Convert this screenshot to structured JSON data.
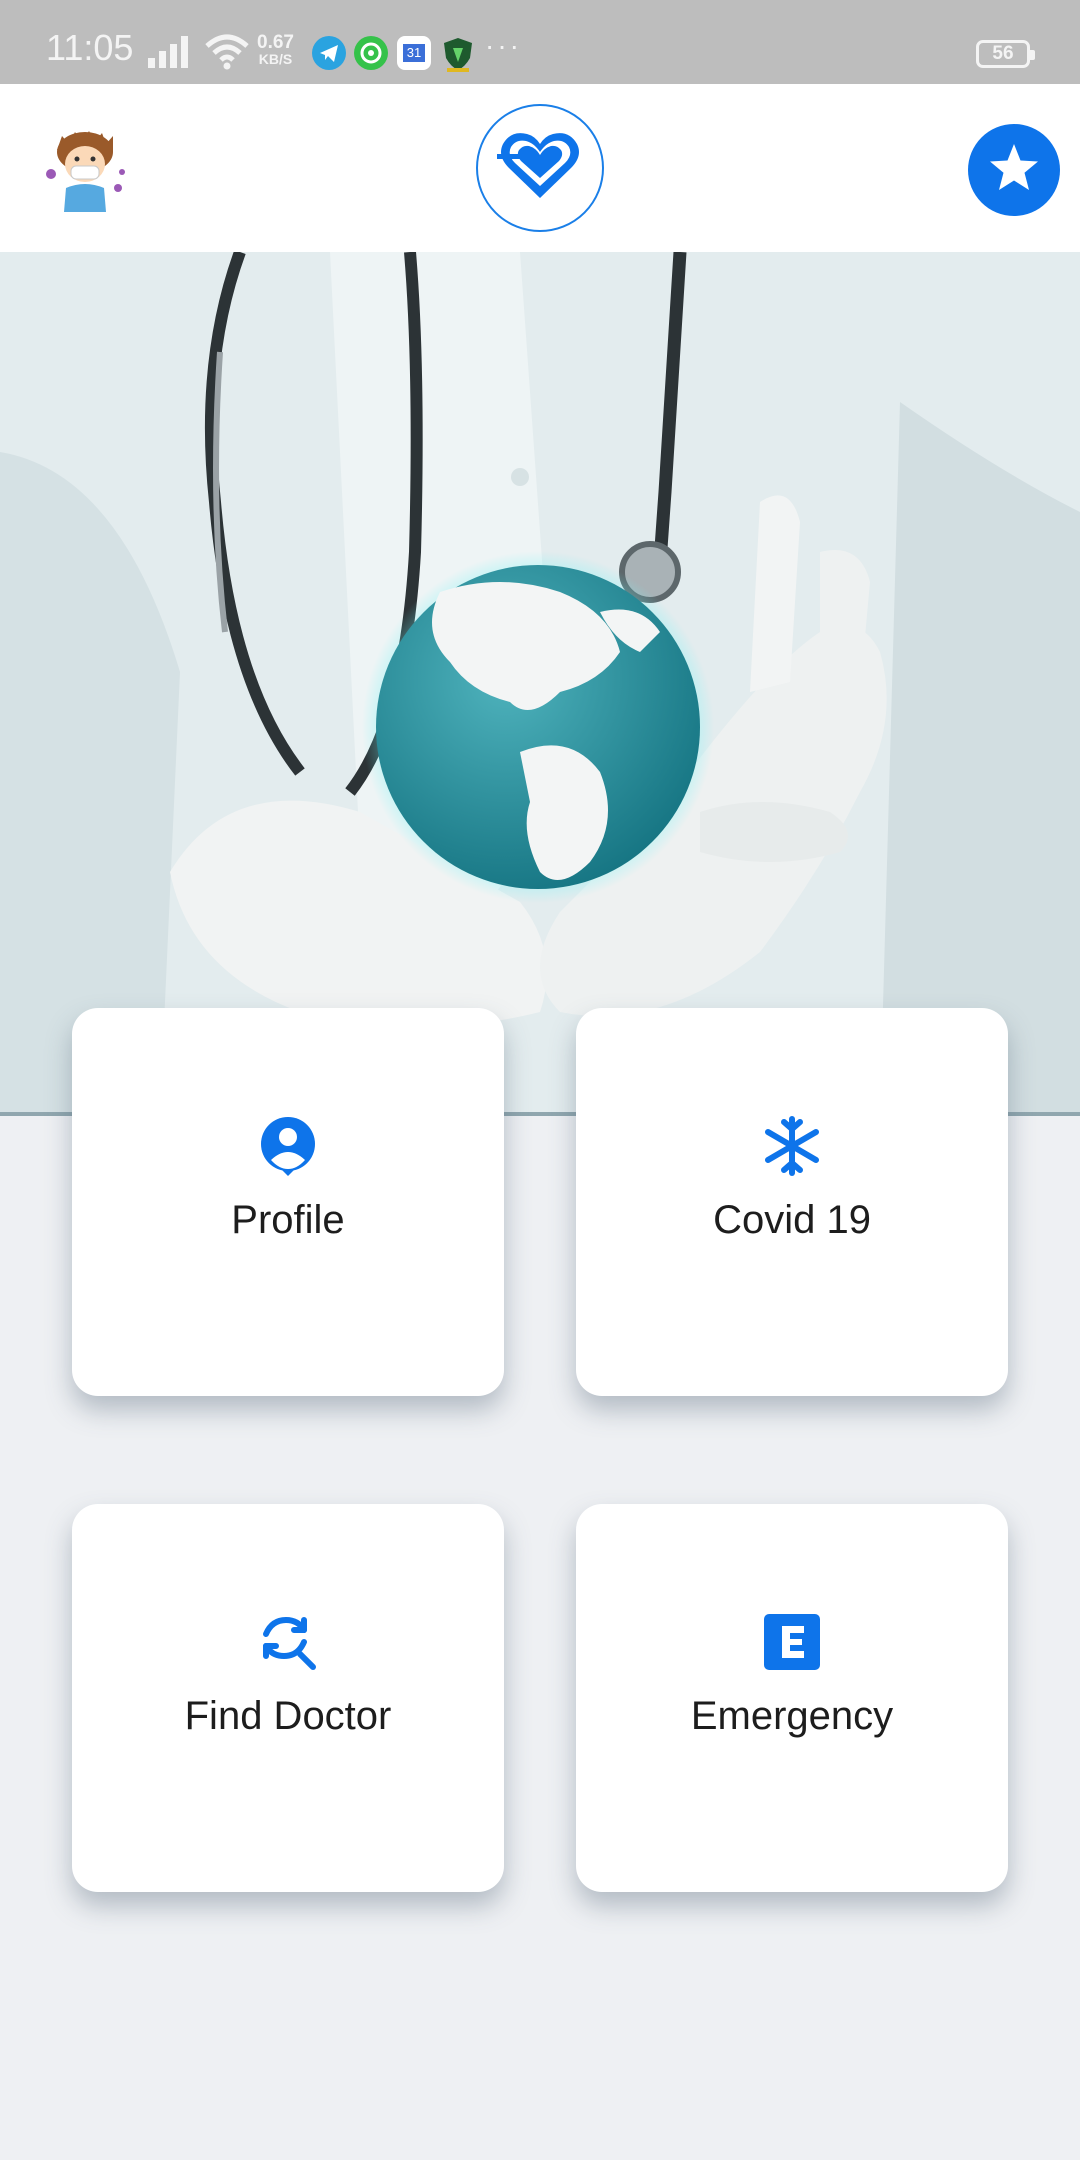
{
  "status_bar": {
    "time": "11:05",
    "net_speed_value": "0.67",
    "net_speed_unit": "KB/S",
    "calendar_day": "31",
    "more": "···",
    "battery": "56",
    "icons": [
      "signal-icon",
      "wifi-icon",
      "telegram-icon",
      "whatsapp-icon",
      "calendar-icon",
      "shield-app-icon",
      "battery-icon"
    ]
  },
  "app_bar": {
    "left_icon": "sick-avatar-icon",
    "center_icon": "heart-icon",
    "right_icon": "star-icon",
    "accent_color": "#0e74ea"
  },
  "hero": {
    "image": "doctor-holding-globe-photo"
  },
  "menu": [
    {
      "label": "Profile",
      "icon": "profile-icon"
    },
    {
      "label": "Covid 19",
      "icon": "snowflake-virus-icon"
    },
    {
      "label": "Find Doctor",
      "icon": "search-refresh-icon"
    },
    {
      "label": "Emergency",
      "icon": "emergency-e-icon"
    }
  ]
}
